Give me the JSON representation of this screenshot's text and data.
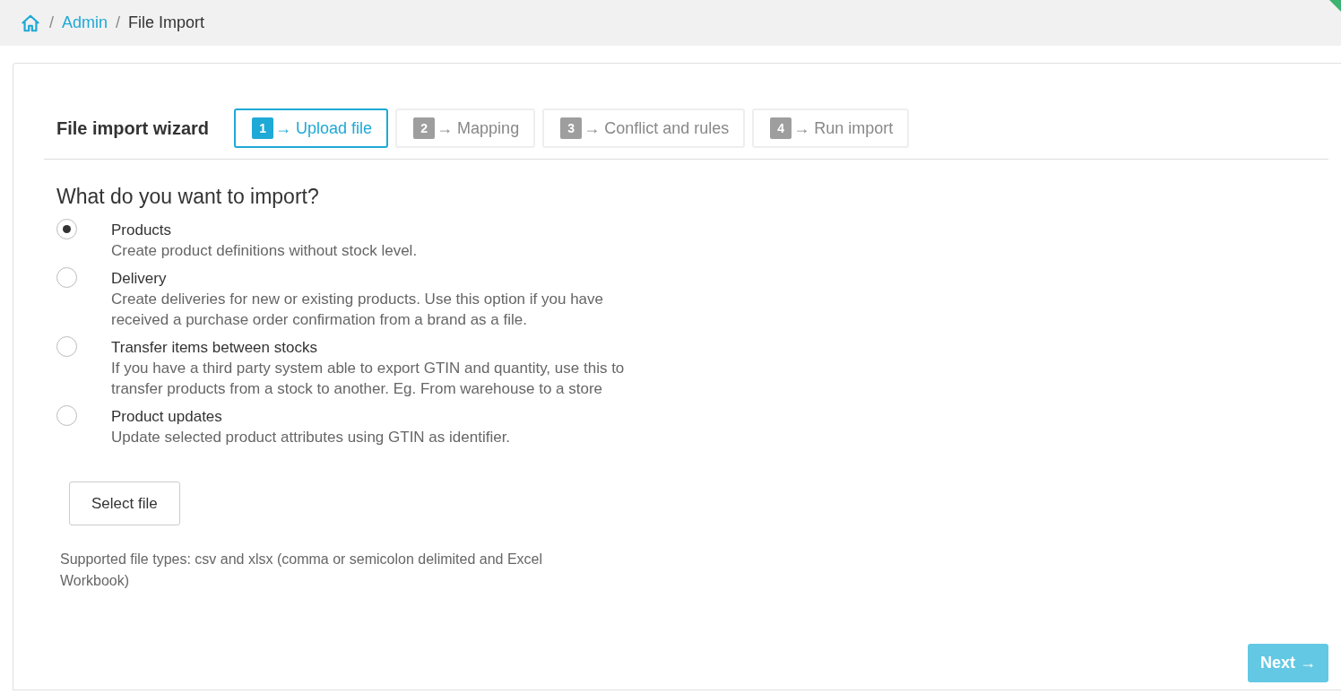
{
  "breadcrumb": [
    {
      "label": "/",
      "kind": "separator"
    },
    {
      "label": "Admin",
      "kind": "link"
    },
    {
      "label": "/",
      "kind": "separator"
    },
    {
      "label": "File Import",
      "kind": "current"
    }
  ],
  "wizard": {
    "title": "File import wizard",
    "steps": [
      {
        "number": "1",
        "label": "→ Upload file",
        "selected": true
      },
      {
        "number": "2",
        "label": "→ Mapping",
        "selected": false
      },
      {
        "number": "3",
        "label": "→ Conflict and rules",
        "selected": false
      },
      {
        "number": "4",
        "label": "→ Run import",
        "selected": false
      }
    ]
  },
  "question": "What do you want to import?",
  "options": [
    {
      "title": "Products",
      "description": "Create product definitions without stock level.",
      "selected": true
    },
    {
      "title": "Delivery",
      "description": "Create deliveries for new or existing products. Use this option if you have received a purchase order confirmation from a brand as a file.",
      "selected": false
    },
    {
      "title": "Transfer items between stocks",
      "description": "If you have a third party system able to export GTIN and quantity, use this to transfer products from a stock to another. Eg. From warehouse to a store",
      "selected": false
    },
    {
      "title": "Product updates",
      "description": "Update selected product attributes using GTIN as identifier.",
      "selected": false
    }
  ],
  "select_file_button": "Select file",
  "supported_types": "Supported file types: csv and xlsx (comma or semicolon delimited and Excel Workbook)",
  "next_button": "Next →"
}
